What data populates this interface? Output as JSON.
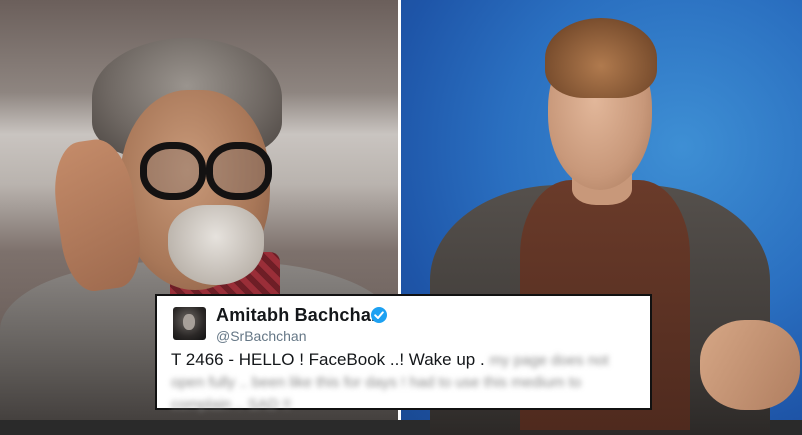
{
  "tweet": {
    "name": "Amitabh Bachchan",
    "handle": "@SrBachchan",
    "text_visible": "T 2466 - HELLO ! FaceBook ..! Wake up .",
    "text_blurred": "my page does not open fully .. been like this for days ! had to use this medium to complain .. SAD !!"
  },
  "icons": {
    "verified": "verified-badge-icon",
    "avatar": "profile-avatar"
  },
  "colors": {
    "verified_blue": "#1da1f2",
    "name_text": "#14171a",
    "handle_text": "#657786",
    "card_border": "#111111"
  }
}
